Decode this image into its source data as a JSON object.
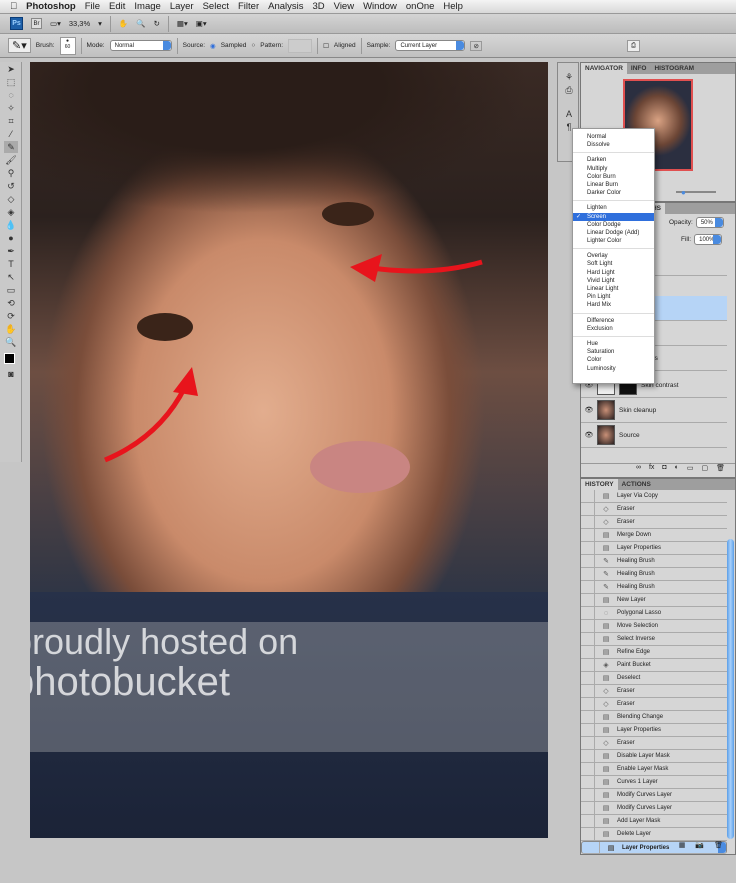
{
  "menubar": {
    "apple": "",
    "app": "Photoshop",
    "items": [
      "File",
      "Edit",
      "Image",
      "Layer",
      "Select",
      "Filter",
      "Analysis",
      "3D",
      "View",
      "Window",
      "onOne",
      "Help"
    ]
  },
  "appbar": {
    "ps": "Ps",
    "br": "Br",
    "zoom": "33,3%"
  },
  "options": {
    "brush_label": "Brush:",
    "brush_size": "60",
    "mode_label": "Mode:",
    "mode_value": "Normal",
    "source_label": "Source:",
    "sampled": "Sampled",
    "pattern": "Pattern:",
    "aligned": "Aligned",
    "sample_label": "Sample:",
    "sample_value": "Current Layer"
  },
  "watermark": {
    "line1": "proudly hosted on",
    "line2": "photobucket"
  },
  "navigator": {
    "tabs": [
      "NAVIGATOR",
      "INFO",
      "HISTOGRAM"
    ]
  },
  "layers": {
    "tab": "PATHS",
    "opacity_label": "Opacity:",
    "opacity": "50%",
    "fill_label": "Fill:",
    "fill": "100%",
    "rows": [
      "",
      "",
      "",
      "",
      "es",
      "Skin contrast",
      "Skin cleanup",
      "Source"
    ]
  },
  "blend_modes": {
    "groups": [
      [
        "Normal",
        "Dissolve"
      ],
      [
        "Darken",
        "Multiply",
        "Color Burn",
        "Linear Burn",
        "Darker Color"
      ],
      [
        "Lighten",
        "Screen",
        "Color Dodge",
        "Linear Dodge (Add)",
        "Lighter Color"
      ],
      [
        "Overlay",
        "Soft Light",
        "Hard Light",
        "Vivid Light",
        "Linear Light",
        "Pin Light",
        "Hard Mix"
      ],
      [
        "Difference",
        "Exclusion"
      ],
      [
        "Hue",
        "Saturation",
        "Color",
        "Luminosity"
      ]
    ],
    "selected": "Screen"
  },
  "history": {
    "tabs": [
      "HISTORY",
      "ACTIONS"
    ],
    "items": [
      {
        "label": "Layer Via Copy",
        "icon": "doc"
      },
      {
        "label": "Eraser",
        "icon": "eraser"
      },
      {
        "label": "Eraser",
        "icon": "eraser"
      },
      {
        "label": "Merge Down",
        "icon": "doc"
      },
      {
        "label": "Layer Properties",
        "icon": "doc"
      },
      {
        "label": "Healing Brush",
        "icon": "bandage"
      },
      {
        "label": "Healing Brush",
        "icon": "bandage"
      },
      {
        "label": "Healing Brush",
        "icon": "bandage"
      },
      {
        "label": "New Layer",
        "icon": "doc"
      },
      {
        "label": "Polygonal Lasso",
        "icon": "lasso"
      },
      {
        "label": "Move Selection",
        "icon": "doc"
      },
      {
        "label": "Select Inverse",
        "icon": "doc"
      },
      {
        "label": "Refine Edge",
        "icon": "doc"
      },
      {
        "label": "Paint Bucket",
        "icon": "bucket"
      },
      {
        "label": "Deselect",
        "icon": "doc"
      },
      {
        "label": "Eraser",
        "icon": "eraser"
      },
      {
        "label": "Eraser",
        "icon": "eraser"
      },
      {
        "label": "Blending Change",
        "icon": "doc"
      },
      {
        "label": "Layer Properties",
        "icon": "doc"
      },
      {
        "label": "Eraser",
        "icon": "eraser"
      },
      {
        "label": "Disable Layer Mask",
        "icon": "doc"
      },
      {
        "label": "Enable Layer Mask",
        "icon": "doc"
      },
      {
        "label": "Curves 1 Layer",
        "icon": "doc"
      },
      {
        "label": "Modify Curves Layer",
        "icon": "doc"
      },
      {
        "label": "Modify Curves Layer",
        "icon": "doc"
      },
      {
        "label": "Add Layer Mask",
        "icon": "doc"
      },
      {
        "label": "Delete Layer",
        "icon": "doc"
      },
      {
        "label": "Layer Properties",
        "icon": "doc",
        "selected": true
      }
    ]
  },
  "colors": {
    "arrow": "#e8141c",
    "selection": "#2f6fdc",
    "history_selected": "#b6d4f6"
  }
}
